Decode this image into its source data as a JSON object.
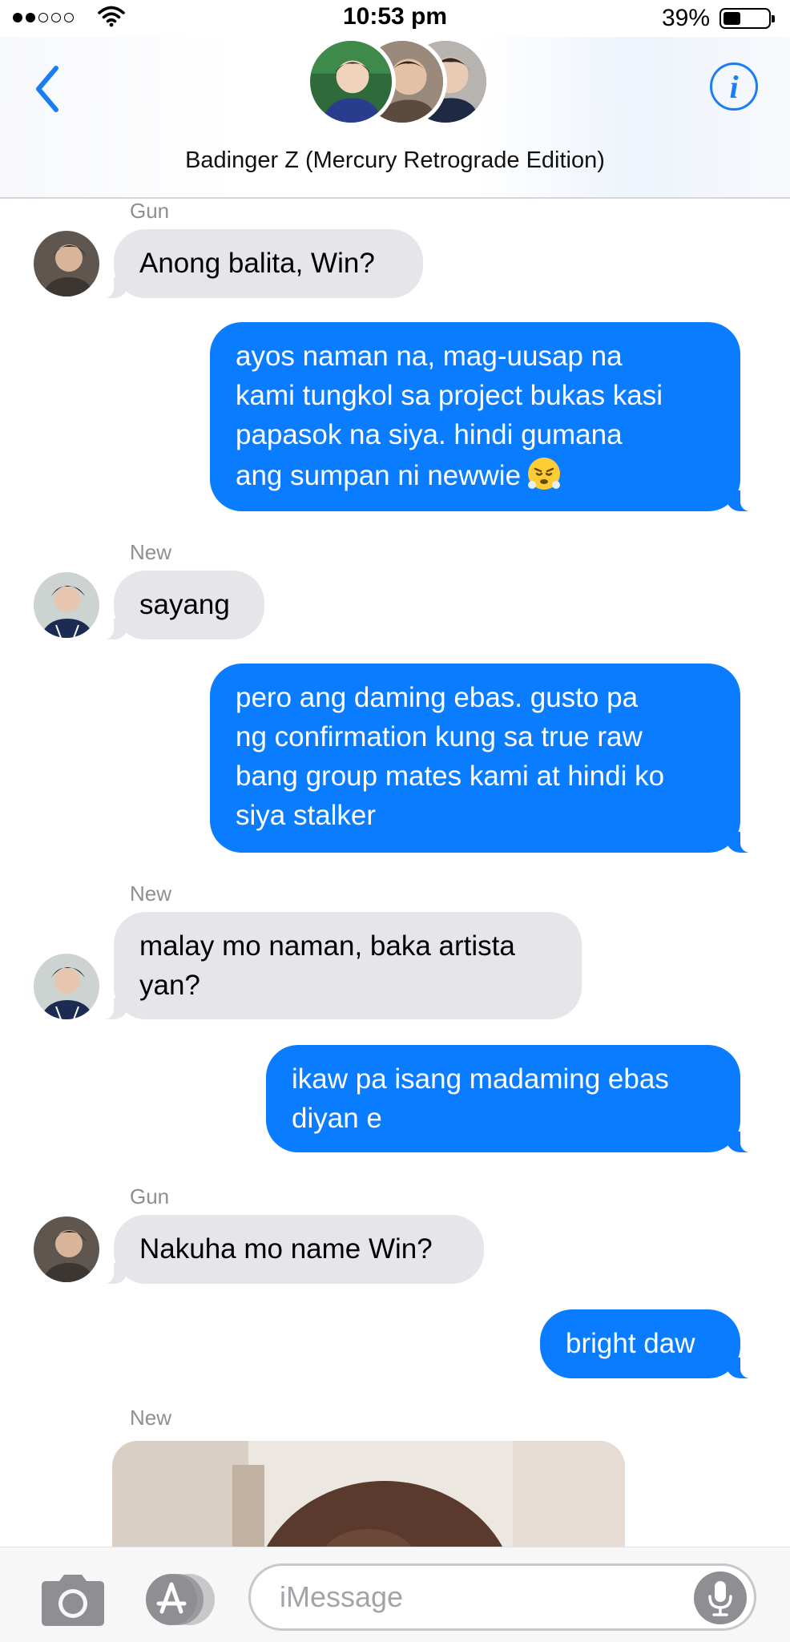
{
  "status_bar": {
    "signal_filled": 2,
    "signal_total": 5,
    "time": "10:53 pm",
    "battery_percent_text": "39%",
    "battery_level": 0.39
  },
  "header": {
    "group_title": "Badinger Z (Mercury Retrograde Edition)",
    "back_icon": "chevron-left-icon",
    "info_icon": "info-icon",
    "info_glyph": "i",
    "accent_color": "#1a7ef2"
  },
  "messages": [
    {
      "sender": "Gun",
      "direction": "incoming",
      "text": "Anong balita, Win?"
    },
    {
      "direction": "outgoing",
      "lines": [
        "ayos naman na, mag-uusap na",
        "kami tungkol sa project bukas kasi",
        "papasok na siya. hindi gumana",
        "ang sumpan ni newwie"
      ],
      "emoji": "huffing-face-emoji"
    },
    {
      "sender": "New",
      "direction": "incoming",
      "text": "sayang"
    },
    {
      "direction": "outgoing",
      "lines": [
        "pero ang daming ebas. gusto pa",
        "ng confirmation kung sa true raw",
        "bang group mates kami at hindi ko",
        "siya stalker"
      ]
    },
    {
      "sender": "New",
      "direction": "incoming",
      "lines": [
        "malay mo naman, baka artista",
        "yan?"
      ]
    },
    {
      "direction": "outgoing",
      "lines": [
        "ikaw pa isang madaming ebas",
        "diyan e"
      ]
    },
    {
      "sender": "Gun",
      "direction": "incoming",
      "text": "Nakuha mo name Win?"
    },
    {
      "direction": "outgoing",
      "text": "bright daw"
    },
    {
      "sender": "New",
      "direction": "incoming",
      "attachment": "image"
    }
  ],
  "colors": {
    "outgoing_bubble": "#0a7cff",
    "incoming_bubble": "#e5e5ea",
    "sender_name": "#8e8e93"
  },
  "input_bar": {
    "placeholder": "iMessage",
    "camera_icon": "camera-icon",
    "apps_icon": "app-store-icon",
    "mic_icon": "microphone-icon"
  }
}
